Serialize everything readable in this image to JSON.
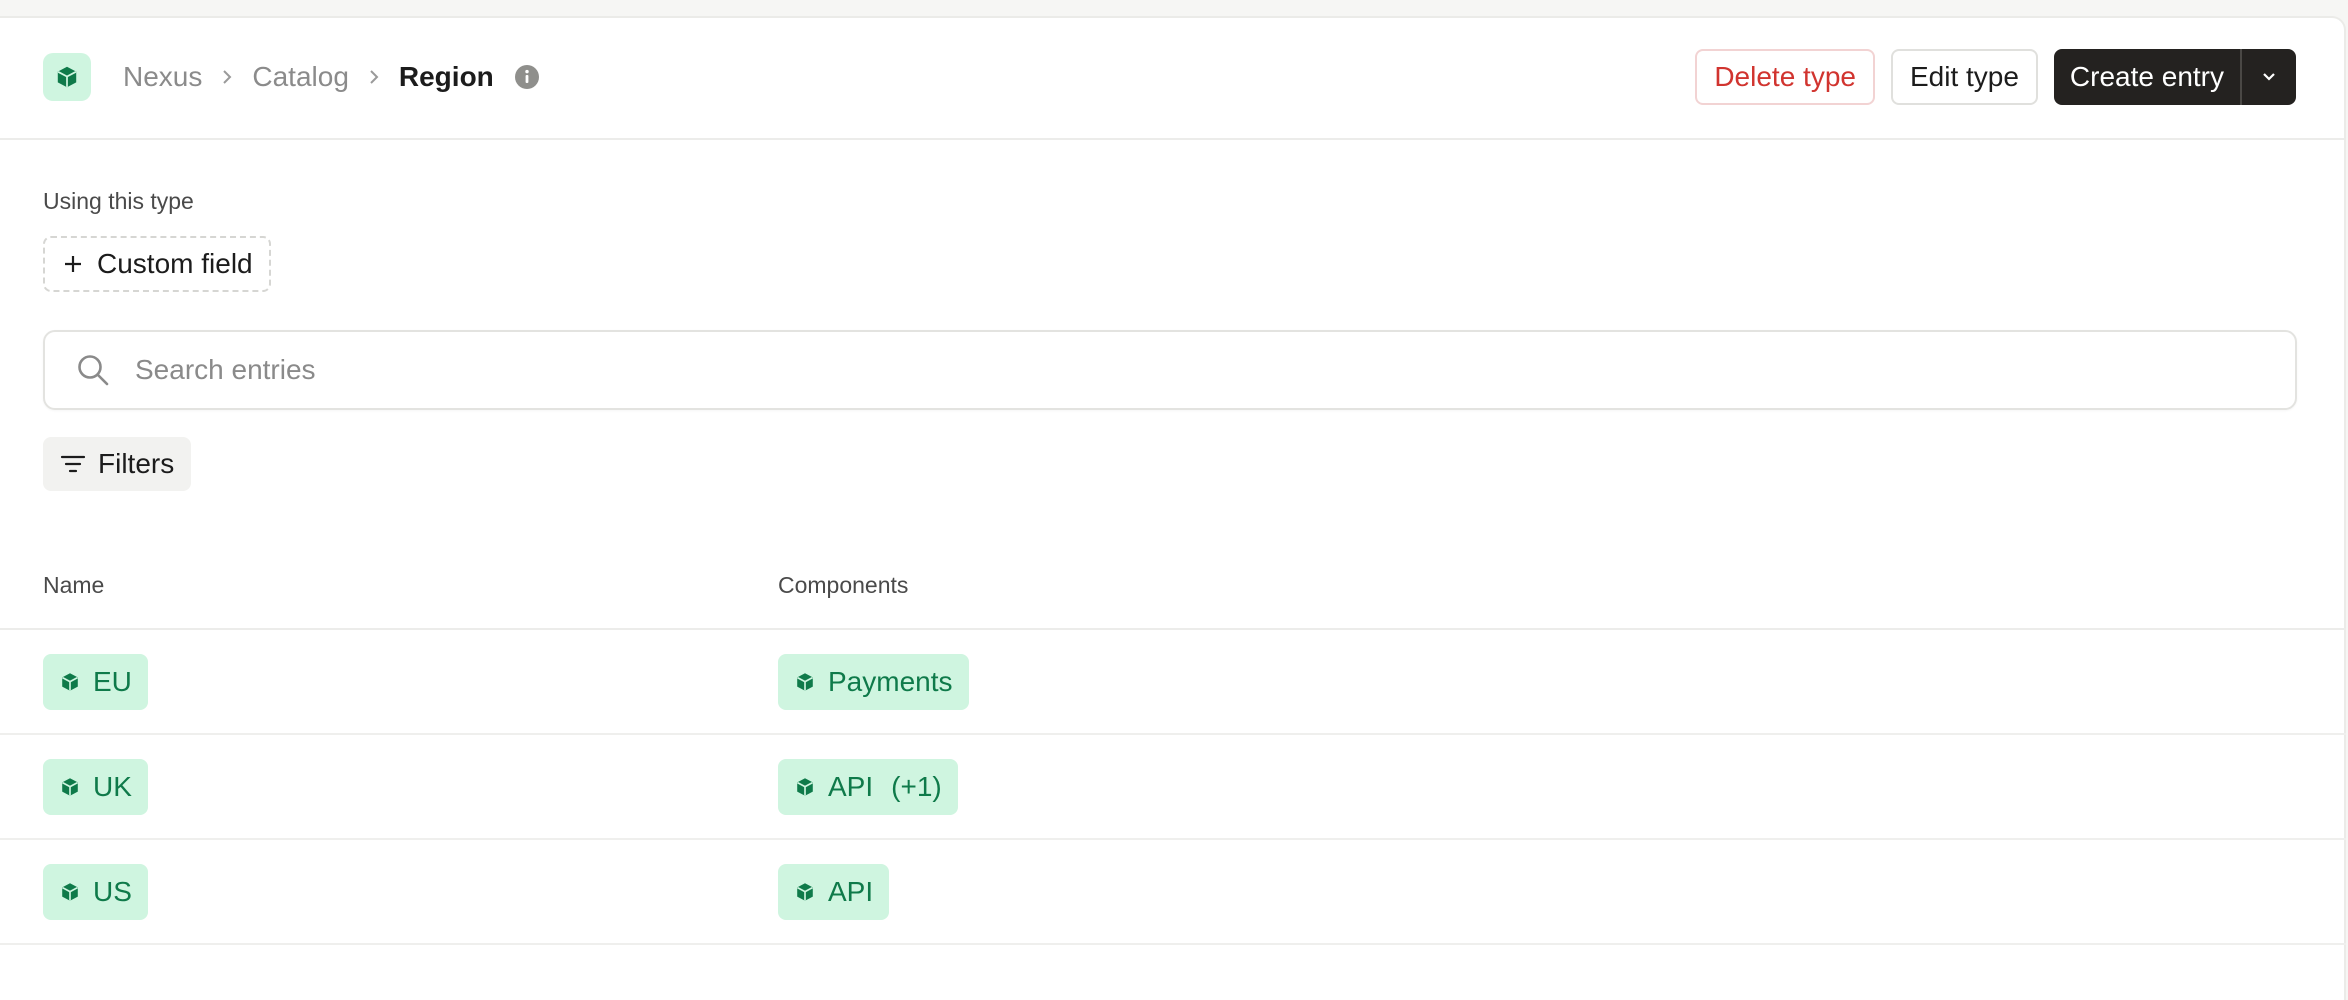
{
  "header": {
    "breadcrumb": [
      "Nexus",
      "Catalog",
      "Region"
    ],
    "actions": {
      "delete_label": "Delete type",
      "edit_label": "Edit type",
      "create_label": "Create entry"
    }
  },
  "usage": {
    "label": "Using this type",
    "custom_field_label": "Custom field"
  },
  "search": {
    "placeholder": "Search entries",
    "value": ""
  },
  "filters": {
    "label": "Filters"
  },
  "table": {
    "columns": [
      "Name",
      "Components"
    ],
    "rows": [
      {
        "name": "EU",
        "component": "Payments",
        "extra": ""
      },
      {
        "name": "UK",
        "component": "API",
        "extra": "(+1)"
      },
      {
        "name": "US",
        "component": "API",
        "extra": ""
      }
    ]
  },
  "colors": {
    "accent": "#0f7a4a",
    "chip_bg": "#cff5e0",
    "danger": "#d1342f",
    "primary_bg": "#242220"
  },
  "icons": {
    "logo": "cube-icon",
    "info": "info-icon",
    "search": "search-icon",
    "filter": "filter-lines-icon",
    "add": "plus-icon",
    "caret": "chevron-down-icon",
    "chip": "cube-icon"
  }
}
